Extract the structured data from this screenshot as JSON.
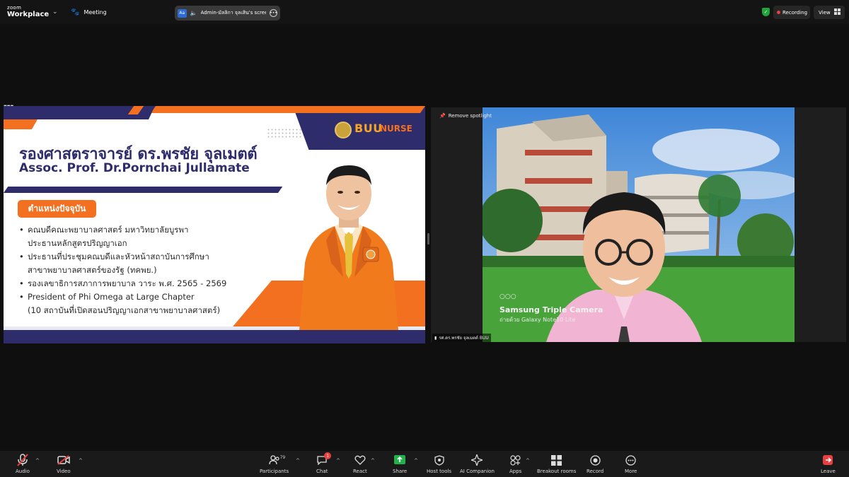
{
  "topbar": {
    "logo_small": "zoom",
    "logo_big": "Workplace",
    "meeting_label": "Meeting",
    "share_text": "Admin-มัลลิกา  จุลเสิน's scree",
    "aa_label": "Aa",
    "recording_label": "Recording",
    "view_label": "View",
    "recording_color": "#e84040",
    "shield_color": "#1fa33a"
  },
  "slide": {
    "thai_name": "รองศาสตราจารย์ ดร.พรชัย จุลเมตต์",
    "eng_name": "Assoc. Prof. Dr.Pornchai Jullamate",
    "badge": "ตำแหน่งปัจจุบัน",
    "logo_buu": "BUU",
    "logo_nurse": "NURSE",
    "colors": {
      "navy": "#2e2c6b",
      "orange": "#f37021"
    },
    "bullets": [
      {
        "text": "คณบดีคณะพยาบาลศาสตร์ มหาวิทยาลัยบูรพา",
        "bullet": true
      },
      {
        "text": "ประธานหลักสูตรปริญญาเอก",
        "bullet": false
      },
      {
        "text": "ประธานที่ประชุมคณบดีและหัวหน้าสถาบันการศึกษา",
        "bullet": true
      },
      {
        "text": "สาขาพยาบาลศาสตร์ของรัฐ (ทคพย.)",
        "bullet": false
      },
      {
        "text": "รองเลขาธิการสภาการพยาบาล วาระ พ.ศ. 2565 - 2569",
        "bullet": true
      },
      {
        "text": "President of Phi Omega at Large Chapter",
        "bullet": true
      },
      {
        "text": "(10 สถาบันที่เปิดสอนปริญญาเอกสาขาพยาบาลศาสตร์)",
        "bullet": false
      }
    ]
  },
  "video": {
    "spotlight_label": "Remove spotlight",
    "participant_name": "รศ.ดร.พรชัย จุลเมตต์ BUU",
    "cam_mark": "○○○",
    "cam_title": "Samsung Triple Camera",
    "cam_sub": "ถ่ายด้วย Galaxy Note10 Lite"
  },
  "toolbar": {
    "audio": "Audio",
    "video": "Video",
    "participants": "Participants",
    "participants_count": "79",
    "chat": "Chat",
    "chat_badge": "1",
    "react": "React",
    "share": "Share",
    "host_tools": "Host tools",
    "ai_companion": "AI Companion",
    "apps": "Apps",
    "breakout": "Breakout rooms",
    "record": "Record",
    "more": "More",
    "leave": "Leave",
    "share_color": "#22b14c",
    "muted_color": "#e84040"
  }
}
